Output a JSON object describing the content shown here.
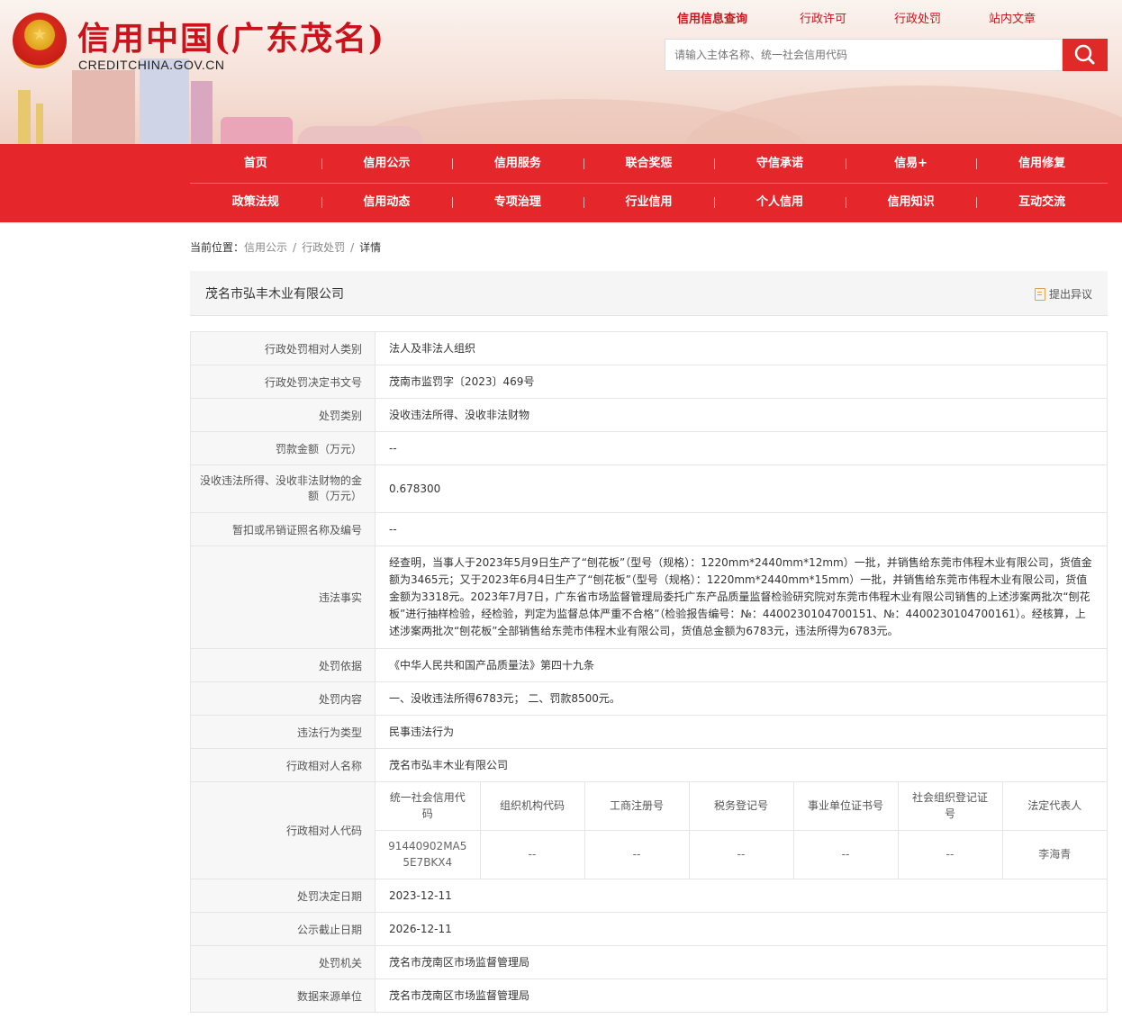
{
  "header": {
    "logo_cn": "信用中国(广东茂名)",
    "logo_en": "CREDITCHINA.GOV.CN",
    "top_links": [
      "信用信息查询",
      "行政许可",
      "行政处罚",
      "站内文章"
    ],
    "search_placeholder": "请输入主体名称、统一社会信用代码"
  },
  "nav": {
    "row1": [
      "首页",
      "信用公示",
      "信用服务",
      "联合奖惩",
      "守信承诺",
      "信易+",
      "信用修复"
    ],
    "row2": [
      "政策法规",
      "信用动态",
      "专项治理",
      "行业信用",
      "个人信用",
      "信用知识",
      "互动交流"
    ]
  },
  "breadcrumb": {
    "prefix": "当前位置：",
    "items": [
      "信用公示",
      "行政处罚",
      "详情"
    ],
    "sep": "/"
  },
  "title": {
    "company": "茂名市弘丰木业有限公司",
    "objection": "提出异议"
  },
  "rows": [
    {
      "label": "行政处罚相对人类别",
      "value": "法人及非法人组织"
    },
    {
      "label": "行政处罚决定书文号",
      "value": "茂南市监罚字〔2023〕469号"
    },
    {
      "label": "处罚类别",
      "value": "没收违法所得、没收非法财物"
    },
    {
      "label": "罚款金额（万元）",
      "value": "--"
    },
    {
      "label": "没收违法所得、没收非法财物的金额（万元）",
      "value": "0.678300"
    },
    {
      "label": "暂扣或吊销证照名称及编号",
      "value": "--"
    },
    {
      "label": "违法事实",
      "value": "经查明，当事人于2023年5月9日生产了“刨花板”（型号（规格）：1220mm*2440mm*12mm）一批，并销售给东莞市伟程木业有限公司，货值金额为3465元；又于2023年6月4日生产了“刨花板”（型号（规格）：1220mm*2440mm*15mm）一批，并销售给东莞市伟程木业有限公司，货值金额为3318元。2023年7月7日，广东省市场监督管理局委托广东产品质量监督检验研究院对东莞市伟程木业有限公司销售的上述涉案两批次“刨花板”进行抽样检验，经检验，判定为监督总体严重不合格”（检验报告编号：№：4400230104700151、№：4400230104700161）。经核算，上述涉案两批次“刨花板”全部销售给东莞市伟程木业有限公司，货值总金额为6783元，违法所得为6783元。"
    },
    {
      "label": "处罚依据",
      "value": "《中华人民共和国产品质量法》第四十九条"
    },
    {
      "label": "处罚内容",
      "value": "一、没收违法所得6783元； 二、罚款8500元。"
    },
    {
      "label": "违法行为类型",
      "value": "民事违法行为"
    },
    {
      "label": "行政相对人名称",
      "value": "茂名市弘丰木业有限公司"
    }
  ],
  "code_row": {
    "label": "行政相对人代码",
    "headers": [
      "统一社会信用代码",
      "组织机构代码",
      "工商注册号",
      "税务登记号",
      "事业单位证书号",
      "社会组织登记证号",
      "法定代表人"
    ],
    "values": [
      "91440902MA55E7BKX4",
      "--",
      "--",
      "--",
      "--",
      "--",
      "李海青"
    ]
  },
  "rows_after": [
    {
      "label": "处罚决定日期",
      "value": "2023-12-11"
    },
    {
      "label": "公示截止日期",
      "value": "2026-12-11"
    },
    {
      "label": "处罚机关",
      "value": "茂名市茂南区市场监督管理局"
    },
    {
      "label": "数据来源单位",
      "value": "茂名市茂南区市场监督管理局"
    }
  ]
}
